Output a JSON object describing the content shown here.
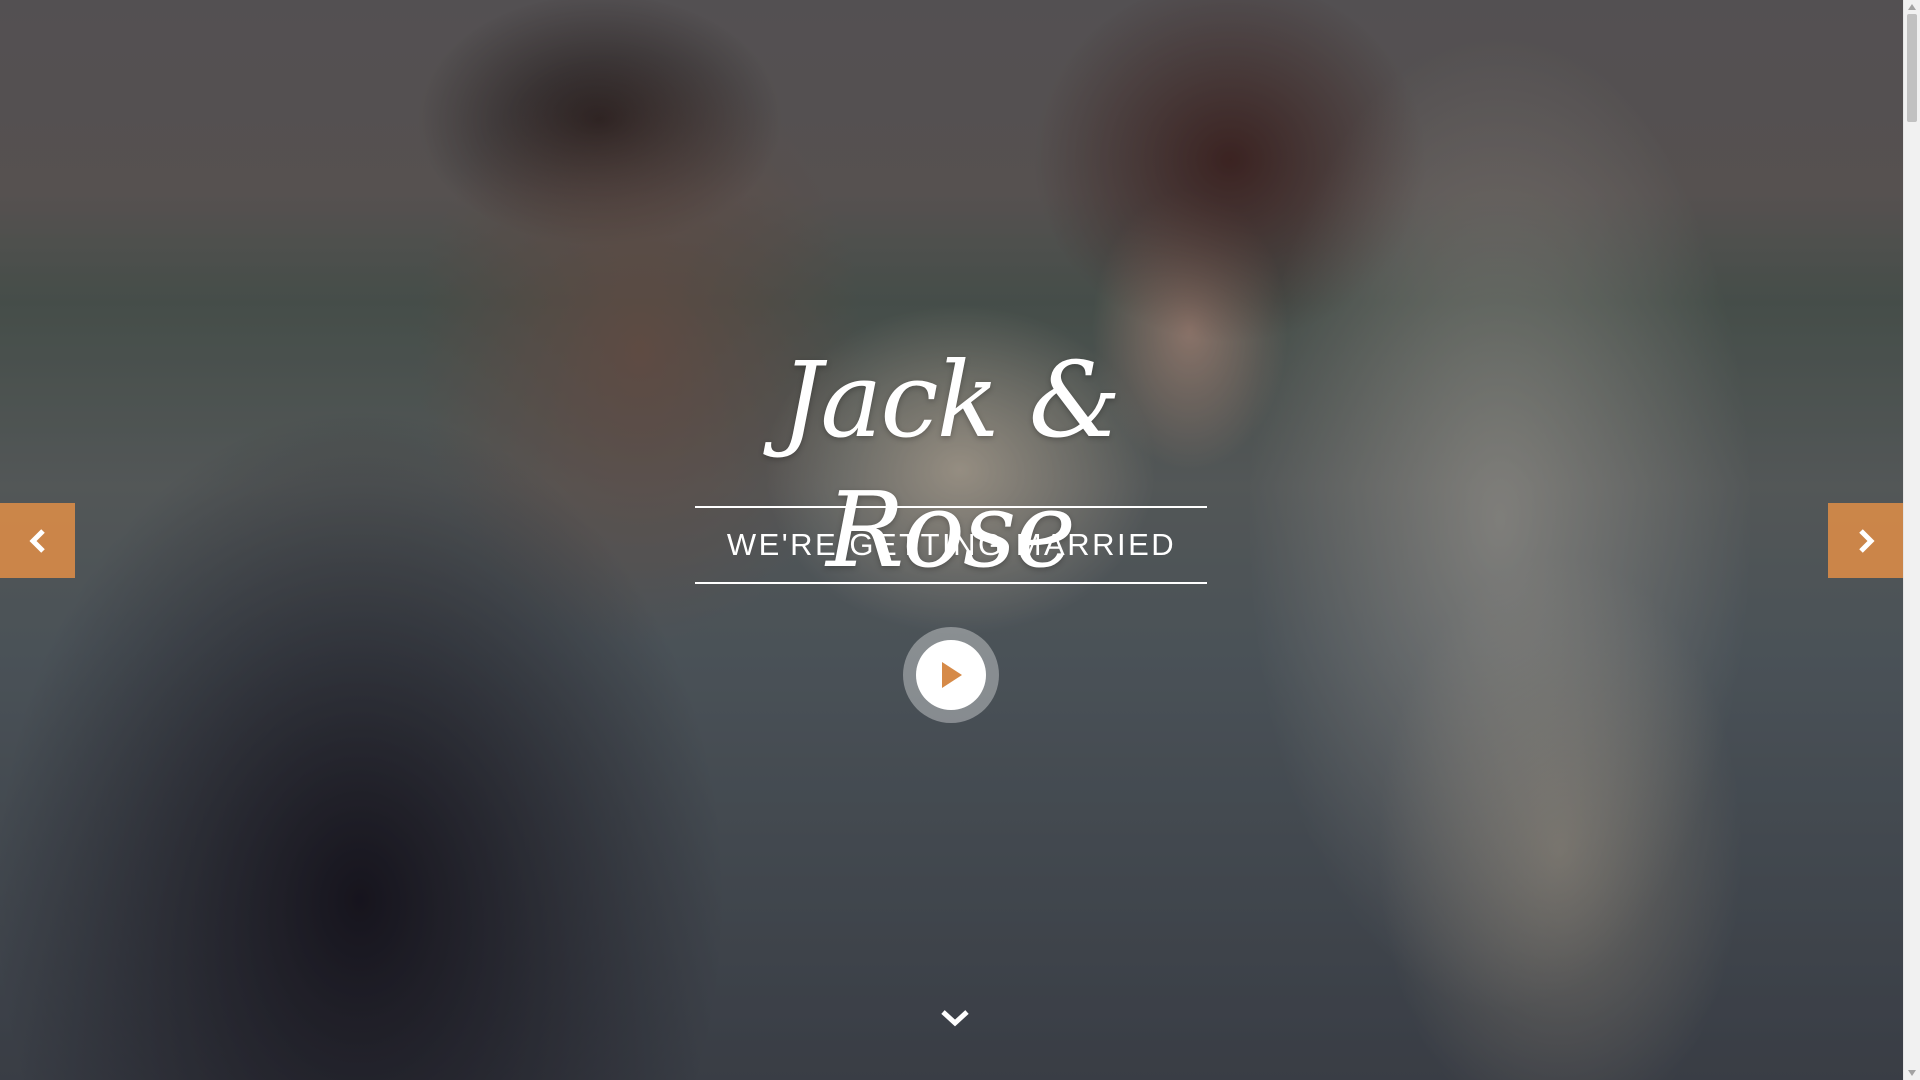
{
  "hero": {
    "names": "Jack & Rose",
    "tagline": "WE'RE GETTING MARRIED"
  },
  "controls": {
    "prev_icon": "chevron-left-icon",
    "next_icon": "chevron-right-icon",
    "play_icon": "play-icon",
    "scroll_icon": "chevron-down-icon"
  },
  "colors": {
    "accent": "#d68a48",
    "text": "#ffffff"
  }
}
